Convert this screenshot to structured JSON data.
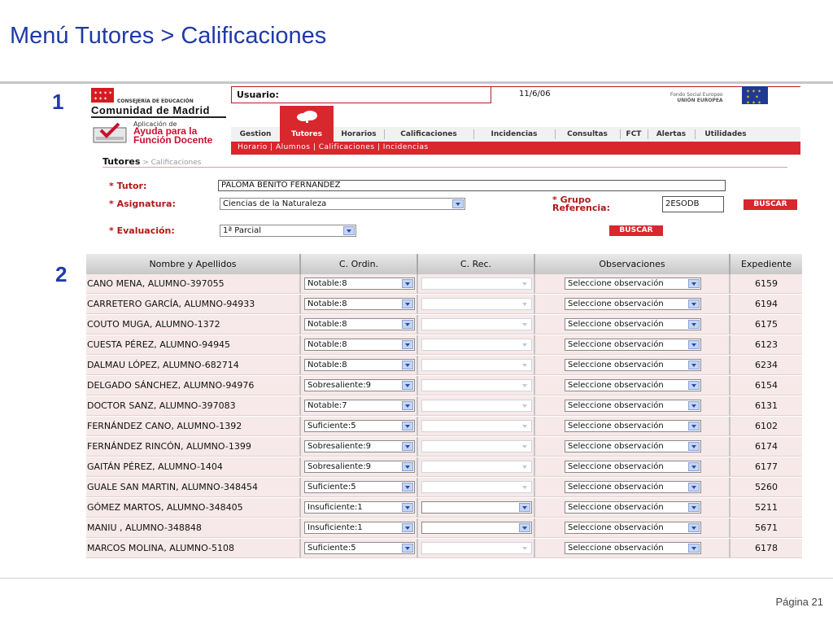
{
  "slide": {
    "title": "Menú Tutores > Calificaciones",
    "marker1": "1",
    "marker2": "2",
    "page": "Página 21"
  },
  "header": {
    "consejeria": "CONSEJERÍA DE EDUCACIÓN",
    "comunidad": "Comunidad de Madrid",
    "app_line1": "Aplicación de",
    "app_line2": "Ayuda para la",
    "app_line3": "Función Docente",
    "user_label": "Usuario:",
    "date": "11/6/06",
    "fse_line1": "Fondo Social Europeo",
    "fse_line2": "UNIÓN EUROPEA"
  },
  "nav": [
    "Gestion",
    "Tutores",
    "Horarios",
    "Calificaciones",
    "Incidencias",
    "Consultas",
    "FCT",
    "Alertas",
    "Utilidades"
  ],
  "subnav": "Horario  |  Alumnos  |  Calificaciones  |  Incidencias",
  "breadcrumb": {
    "main": "Tutores",
    "rest": " > Calificaciones"
  },
  "form": {
    "tutor_label": "* Tutor:",
    "tutor_value": "PALOMA BENITO FERNANDEZ",
    "asignatura_label": "* Asignatura:",
    "asignatura_value": "Ciencias de la Naturaleza",
    "grupo_label_1": "* Grupo",
    "grupo_label_2": "Referencia:",
    "grupo_value": "2ESODB",
    "buscar_1": "BUSCAR",
    "evaluacion_label": "* Evaluación:",
    "evaluacion_value": "1ª Parcial",
    "buscar_2": "BUSCAR"
  },
  "table": {
    "columns": [
      "Nombre y Apellidos",
      "C. Ordin.",
      "C. Rec.",
      "Observaciones",
      "Expediente"
    ],
    "obs_default": "Seleccione observación",
    "rows": [
      {
        "name": "CANO MENA, ALUMNO-397055",
        "grade": "Notable:8",
        "exp": "6159"
      },
      {
        "name": "CARRETERO GARCÍA, ALUMNO-94933",
        "grade": "Notable:8",
        "exp": "6194"
      },
      {
        "name": "COUTO MUGA, ALUMNO-1372",
        "grade": "Notable:8",
        "exp": "6175"
      },
      {
        "name": "CUESTA PÉREZ, ALUMNO-94945",
        "grade": "Notable:8",
        "exp": "6123"
      },
      {
        "name": "DALMAU LÓPEZ, ALUMNO-682714",
        "grade": "Notable:8",
        "exp": "6234"
      },
      {
        "name": "DELGADO SÁNCHEZ, ALUMNO-94976",
        "grade": "Sobresaliente:9",
        "exp": "6154"
      },
      {
        "name": "DOCTOR SANZ, ALUMNO-397083",
        "grade": "Notable:7",
        "exp": "6131"
      },
      {
        "name": "FERNÁNDEZ CANO, ALUMNO-1392",
        "grade": "Suficiente:5",
        "exp": "6102"
      },
      {
        "name": "FERNÁNDEZ RINCÓN, ALUMNO-1399",
        "grade": "Sobresaliente:9",
        "exp": "6174"
      },
      {
        "name": "GAITÁN PÉREZ, ALUMNO-1404",
        "grade": "Sobresaliente:9",
        "exp": "6177"
      },
      {
        "name": "GUALE SAN MARTIN, ALUMNO-348454",
        "grade": "Suficiente:5",
        "exp": "5260"
      },
      {
        "name": "GÓMEZ MARTOS, ALUMNO-348405",
        "grade": "Insuficiente:1",
        "exp": "5211",
        "rec_enabled": true
      },
      {
        "name": "MANIU , ALUMNO-348848",
        "grade": "Insuficiente:1",
        "exp": "5671",
        "rec_enabled": true
      },
      {
        "name": "MARCOS MOLINA, ALUMNO-5108",
        "grade": "Suficiente:5",
        "exp": "6178"
      }
    ]
  }
}
